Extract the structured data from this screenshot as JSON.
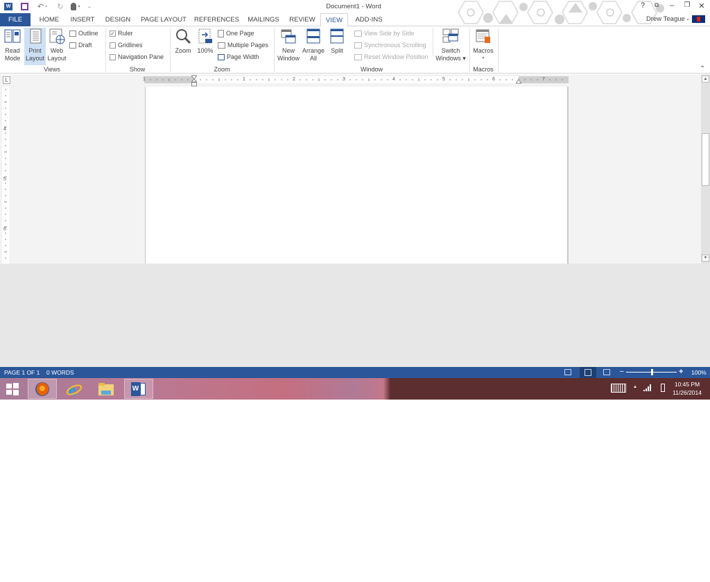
{
  "window": {
    "title": "Document1 - Word",
    "user": "Drew Teague",
    "controls": {
      "help": "?",
      "ribbon_display": "⧉",
      "minimize": "–",
      "restore": "❐",
      "close": "✕"
    }
  },
  "quick_access": {
    "icons": [
      "word-logo-icon",
      "save-icon",
      "undo-icon",
      "redo-icon",
      "touch-mode-icon",
      "customize-icon"
    ],
    "undo_glyph": "↶",
    "redo_glyph": "↻",
    "customize_glyph": "⩡"
  },
  "tabs": [
    {
      "label": "FILE"
    },
    {
      "label": "HOME"
    },
    {
      "label": "INSERT"
    },
    {
      "label": "DESIGN"
    },
    {
      "label": "PAGE LAYOUT"
    },
    {
      "label": "REFERENCES"
    },
    {
      "label": "MAILINGS"
    },
    {
      "label": "REVIEW"
    },
    {
      "label": "VIEW",
      "active": true
    },
    {
      "label": "ADD-INS"
    }
  ],
  "ribbon": {
    "views": {
      "label": "Views",
      "read_mode": [
        "Read",
        "Mode"
      ],
      "print_layout": [
        "Print",
        "Layout"
      ],
      "web_layout": [
        "Web",
        "Layout"
      ],
      "outline": "Outline",
      "draft": "Draft",
      "selected": "Print Layout"
    },
    "show": {
      "label": "Show",
      "ruler": {
        "label": "Ruler",
        "checked": true,
        "mark": "✓"
      },
      "gridlines": {
        "label": "Gridlines",
        "checked": false
      },
      "navigation_pane": {
        "label": "Navigation Pane",
        "checked": false
      }
    },
    "zoom": {
      "label": "Zoom",
      "zoom": "Zoom",
      "hundred": "100%",
      "one_page": "One Page",
      "multiple_pages": "Multiple Pages",
      "page_width": "Page Width"
    },
    "window": {
      "label": "Window",
      "new_window": [
        "New",
        "Window"
      ],
      "arrange_all": [
        "Arrange",
        "All"
      ],
      "split": "Split",
      "view_side_by_side": "View Side by Side",
      "synchronous_scrolling": "Synchronous Scrolling",
      "reset_window_position": "Reset Window Position",
      "switch_windows": [
        "Switch",
        "Windows ▾"
      ]
    },
    "macros": {
      "label": "Macros",
      "macros": "Macros",
      "dropdown": "▾"
    },
    "collapse_glyph": "⌃"
  },
  "ruler": {
    "corner": "L",
    "h_numbers": [
      "1",
      "1",
      "2",
      "3",
      "4",
      "5",
      "6",
      "7"
    ],
    "v_numbers": [
      "4",
      "5",
      "6"
    ]
  },
  "scrollbar": {
    "up": "▲",
    "down": "▼",
    "position": 0.42
  },
  "statusbar": {
    "page": "PAGE 1 OF 1",
    "words": "0 WORDS",
    "zoom": "100%",
    "zoom_minus": "–",
    "zoom_plus": "+",
    "zoom_level": 1.0
  },
  "taskbar": {
    "apps": [
      "start",
      "firefox",
      "internet-explorer",
      "file-explorer",
      "word"
    ],
    "word_label": "W",
    "time": "10:45 PM",
    "date": "11/26/2014",
    "tray_up": "▲"
  },
  "colors": {
    "accent": "#2b579a",
    "taskbar_dark": "#5c2e2f"
  }
}
